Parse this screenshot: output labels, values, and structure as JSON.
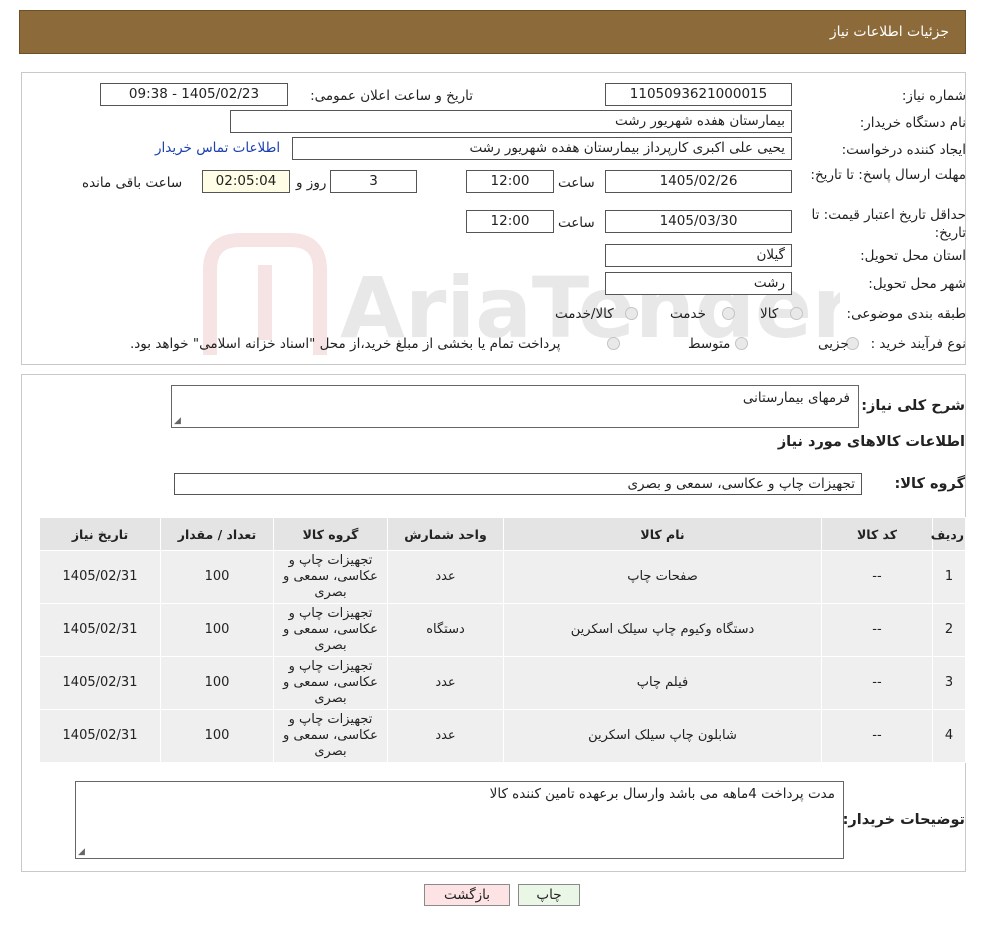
{
  "header": {
    "title": "جزئیات اطلاعات نیاز"
  },
  "form": {
    "need_number_label": "شماره نیاز:",
    "need_number": "1105093621000015",
    "announce_label": "تاریخ و ساعت اعلان عمومی:",
    "announce_value": "1405/02/23 - 09:38",
    "buyer_org_label": "نام دستگاه خریدار:",
    "buyer_org": "بیمارستان هفده شهریور رشت",
    "creator_label": "ایجاد کننده درخواست:",
    "creator": "یحیی علی اکبری کارپرداز بیمارستان هفده شهریور رشت",
    "contact_link": "اطلاعات تماس خریدار",
    "reply_deadline_label": "مهلت ارسال پاسخ: تا تاریخ:",
    "reply_date": "1405/02/26",
    "time_label": "ساعت",
    "reply_time": "12:00",
    "days": "3",
    "days_label": "روز و",
    "remaining_time": "02:05:04",
    "remaining_label": "ساعت باقی مانده",
    "price_validity_label": "حداقل تاریخ اعتبار قیمت: تا تاریخ:",
    "price_date": "1405/03/30",
    "price_time": "12:00",
    "province_label": "استان محل تحویل:",
    "province": "گیلان",
    "city_label": "شهر محل تحویل:",
    "city": "رشت",
    "category_label": "طبقه بندی موضوعی:",
    "category_options": [
      "کالا",
      "خدمت",
      "کالا/خدمت"
    ],
    "process_label": "نوع فرآیند خرید :",
    "process_options": [
      "جزیی",
      "متوسط"
    ],
    "process_note": "پرداخت تمام یا بخشی از مبلغ خرید،از محل \"اسناد خزانه اسلامی\" خواهد بود."
  },
  "details": {
    "summary_label": "شرح کلی نیاز:",
    "summary": "فرمهای بیمارستانی",
    "goods_info_title": "اطلاعات کالاهای مورد نیاز",
    "goods_group_label": "گروه کالا:",
    "goods_group": "تجهیزات چاپ و عکاسی، سمعی و بصری",
    "table": {
      "headers": [
        "ردیف",
        "کد کالا",
        "نام کالا",
        "واحد شمارش",
        "گروه کالا",
        "تعداد / مقدار",
        "تاریخ نیاز"
      ],
      "rows": [
        [
          "1",
          "--",
          "صفحات چاپ",
          "عدد",
          "تجهیزات چاپ و عکاسی، سمعی و بصری",
          "100",
          "1405/02/31"
        ],
        [
          "2",
          "--",
          "دستگاه وکیوم چاپ سیلک اسکرین",
          "دستگاه",
          "تجهیزات چاپ و عکاسی، سمعی و بصری",
          "100",
          "1405/02/31"
        ],
        [
          "3",
          "--",
          "فیلم چاپ",
          "عدد",
          "تجهیزات چاپ و عکاسی، سمعی و بصری",
          "100",
          "1405/02/31"
        ],
        [
          "4",
          "--",
          "شابلون چاپ سیلک اسکرین",
          "عدد",
          "تجهیزات چاپ و عکاسی، سمعی و بصری",
          "100",
          "1405/02/31"
        ]
      ]
    },
    "buyer_notes_label": "توضیحات خریدار:",
    "buyer_notes": "مدت پرداخت 4ماهه می باشد وارسال برعهده تامین کننده کالا"
  },
  "buttons": {
    "print": "چاپ",
    "back": "بازگشت"
  },
  "watermark": {
    "text": "AriaTender.neT"
  },
  "colors": {
    "header_bg": "#8d6a3a",
    "link": "#1a3fb0",
    "back_btn": "#fde3e3",
    "print_btn": "#eaf6e6"
  }
}
